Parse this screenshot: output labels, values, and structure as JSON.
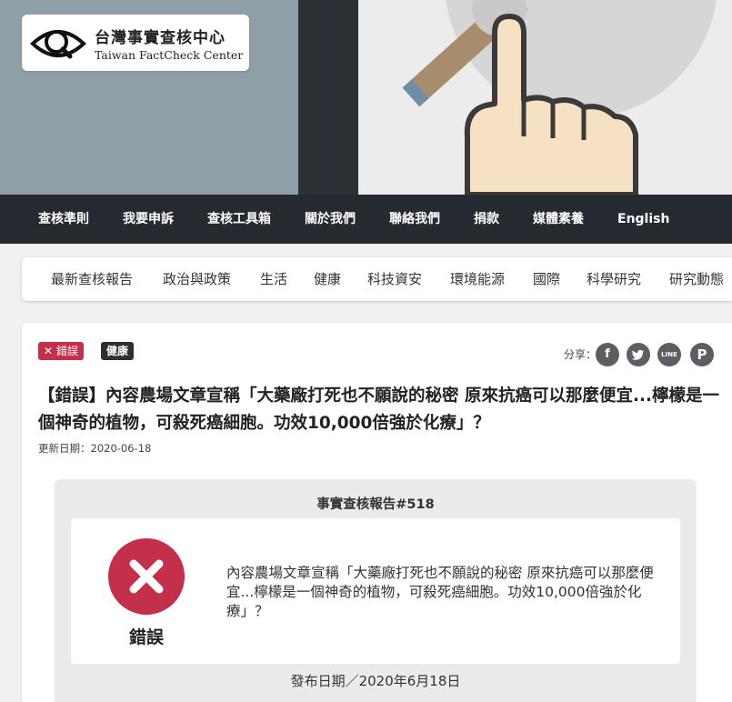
{
  "logo": {
    "zh": "台灣事實查核中心",
    "en": "Taiwan FactCheck Center"
  },
  "main_nav": [
    "查核準則",
    "我要申訴",
    "查核工具箱",
    "關於我們",
    "聯絡我們",
    "捐款",
    "媒體素養",
    "English"
  ],
  "sub_nav": [
    "最新查核報告",
    "政治與政策",
    "生活",
    "健康",
    "科技資安",
    "環境能源",
    "國際",
    "科學研究",
    "研究動態"
  ],
  "article": {
    "badges": {
      "verdict": "錯誤",
      "category": "健康"
    },
    "share_label": "分享：",
    "share_icons": [
      "facebook-icon",
      "twitter-icon",
      "line-icon",
      "plurk-icon"
    ],
    "title": "【錯誤】內容農場文章宣稱「大藥廠打死也不願說的秘密 原來抗癌可以那麼便宜...檸檬是一個神奇的植物，可殺死癌細胞。功效10,000倍強於化療」？",
    "updated": "更新日期：2020-06-18",
    "report": {
      "title": "事實查核報告#518",
      "verdict": "錯誤",
      "claim": "內容農場文章宣稱「大藥廠打死也不願說的秘密 原來抗癌可以那麼便宜...檸檬是一個神奇的植物，可殺死癌細胞。功效10,000倍強於化療」？",
      "publish_date": "發布日期／2020年6月18日"
    }
  },
  "colors": {
    "nav_bg": "#252a30",
    "verdict_red": "#c42f4a",
    "share_grey": "#5b5f64"
  }
}
